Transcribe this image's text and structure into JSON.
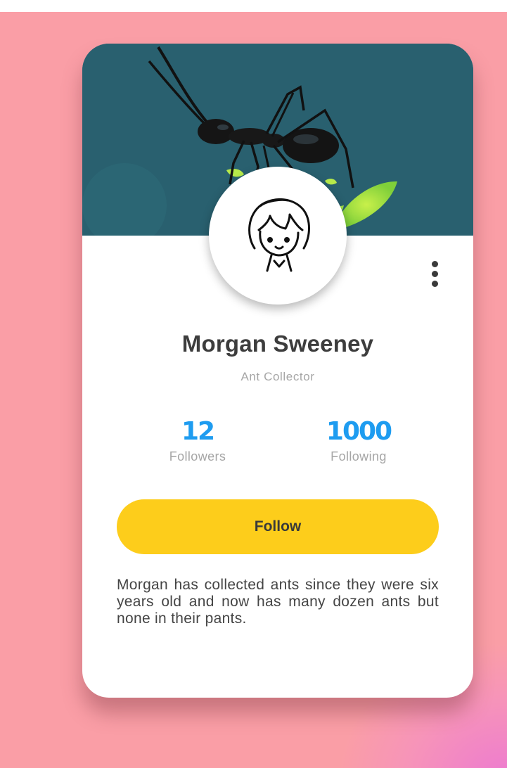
{
  "profile": {
    "name": "Morgan Sweeney",
    "role": "Ant Collector",
    "bio": "Morgan has collected ants since they were six years old and now has many dozen ants but none in their pants."
  },
  "stats": {
    "followers_value": "12",
    "followers_label": "Followers",
    "following_value": "1000",
    "following_label": "Following"
  },
  "actions": {
    "follow_label": "Follow",
    "menu_icon": "more-vertical-icon"
  },
  "colors": {
    "background": "#fa9ea6",
    "cover": "#2a6372",
    "accent_blue": "#1e9cf0",
    "follow_button": "#fdcd1b"
  },
  "images": {
    "cover": "ant-on-leaf-photo",
    "avatar": "cartoon-person-avatar"
  }
}
